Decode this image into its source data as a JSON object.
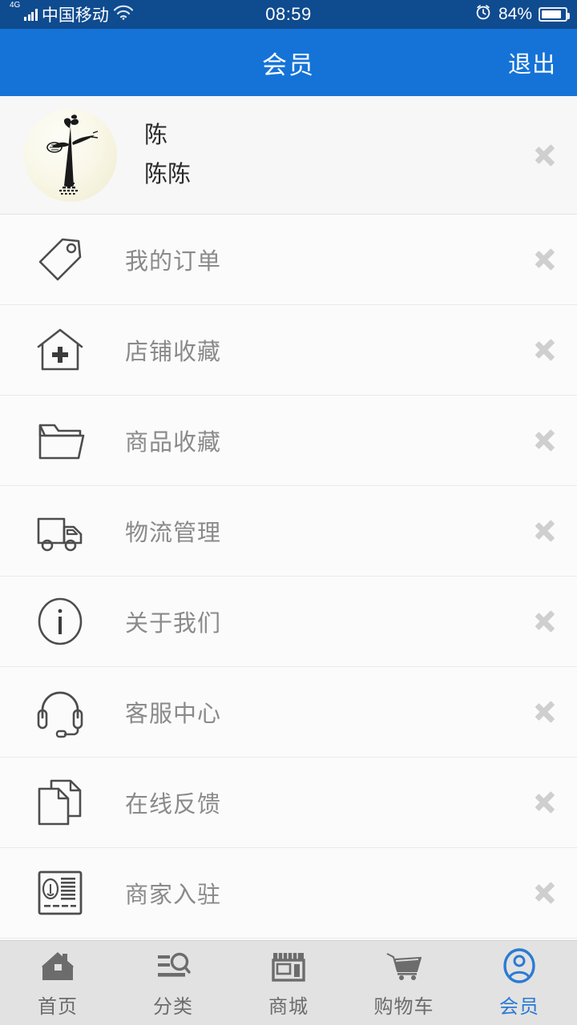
{
  "status_bar": {
    "network_type": "4G",
    "carrier": "中国移动",
    "wifi_icon": "wifi-icon",
    "time": "08:59",
    "alarm_icon": "alarm-icon",
    "battery_percent": "84%",
    "battery_level": 84,
    "bg_color": "#0f4b8f"
  },
  "nav": {
    "title": "会员",
    "action_label": "退出",
    "bg_color": "#1573d7",
    "text_color": "#ffffff"
  },
  "profile": {
    "avatar_icon": "avatar-ink-tree",
    "name_line1": "陈",
    "name_line2": "陈陈",
    "chevron_icon": "chevron-right-icon"
  },
  "menu": {
    "items": [
      {
        "label": "我的订单",
        "icon": "tag-icon",
        "chevron": "chevron-right-icon"
      },
      {
        "label": "店铺收藏",
        "icon": "house-plus-icon",
        "chevron": "chevron-right-icon"
      },
      {
        "label": "商品收藏",
        "icon": "folder-icon",
        "chevron": "chevron-right-icon"
      },
      {
        "label": "物流管理",
        "icon": "truck-icon",
        "chevron": "chevron-right-icon"
      },
      {
        "label": "关于我们",
        "icon": "info-circle-icon",
        "chevron": "chevron-right-icon"
      },
      {
        "label": "客服中心",
        "icon": "headset-icon",
        "chevron": "chevron-right-icon"
      },
      {
        "label": "在线反馈",
        "icon": "documents-icon",
        "chevron": "chevron-right-icon"
      },
      {
        "label": "商家入驻",
        "icon": "id-card-icon",
        "chevron": "chevron-right-icon"
      }
    ]
  },
  "tabbar": {
    "active_color": "#2a7bd4",
    "inactive_color": "#6c6c6c",
    "bg_color": "#e2e2e2",
    "tabs": [
      {
        "label": "首页",
        "icon": "home-icon",
        "active": false
      },
      {
        "label": "分类",
        "icon": "category-search-icon",
        "active": false
      },
      {
        "label": "商城",
        "icon": "storefront-icon",
        "active": false
      },
      {
        "label": "购物车",
        "icon": "cart-icon",
        "active": false
      },
      {
        "label": "会员",
        "icon": "user-circle-icon",
        "active": true
      }
    ]
  }
}
